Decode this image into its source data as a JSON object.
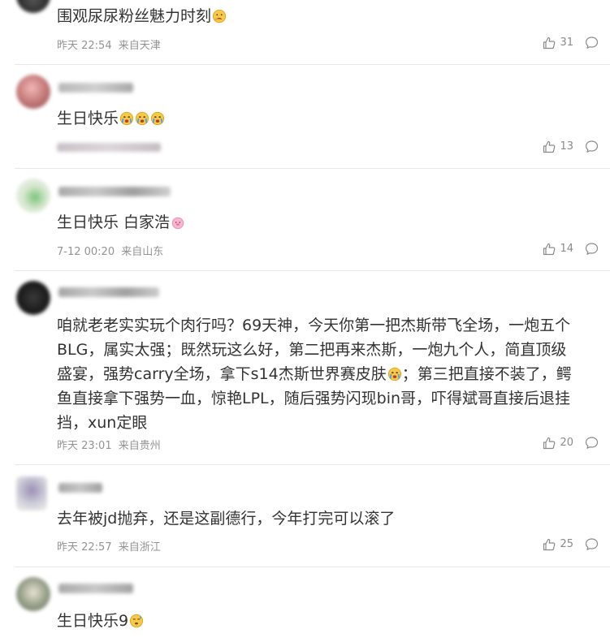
{
  "comments": [
    {
      "text": "围观尿尿粉丝魅力时刻",
      "emojis": [
        "thinking-face"
      ],
      "time": "昨天 22:54",
      "location": "来自天津",
      "likes": "31"
    },
    {
      "text": "生日快乐",
      "emojis": [
        "crying-face",
        "crying-face",
        "crying-face"
      ],
      "time": "",
      "location": "",
      "likes": "13"
    },
    {
      "text": "生日快乐 白家浩",
      "emojis": [
        "pig-face"
      ],
      "time": "7-12 00:20",
      "location": "来自山东",
      "likes": "14"
    },
    {
      "text_lines": [
        "咱就老老实实玩个肉行吗？69天神，今天你第一把杰斯带飞全场，一炮五个",
        "BLG，属实太强；既然玩这么好，第二把再来杰斯，一炮九个人，简直顶级",
        "盛宴，强势carry全场，拿下s14杰斯世界赛皮肤",
        "鱼直接拿下强势一血，惊艳LPL，随后强势闪现bin哥，吓得斌哥直接后退挂",
        "挡，xun定眼"
      ],
      "line3_suffix": "；第三把直接不装了，鳄",
      "emojis": [
        "crying-face"
      ],
      "time": "昨天 23:01",
      "location": "来自贵州",
      "likes": "20"
    },
    {
      "text": "去年被jd抛弃，还是这副德行，今年打完可以滚了",
      "emojis": [],
      "time": "昨天 22:57",
      "location": "来自浙江",
      "likes": "25"
    },
    {
      "text": "生日快乐9",
      "emojis": [
        "sweat-face"
      ],
      "time": "",
      "location": "",
      "likes": ""
    }
  ],
  "icons": {
    "like": "thumbs-up-icon",
    "reply": "comment-bubble-icon"
  },
  "colors": {
    "text": "#333333",
    "meta": "#939393",
    "divider": "#e8e8e8"
  }
}
